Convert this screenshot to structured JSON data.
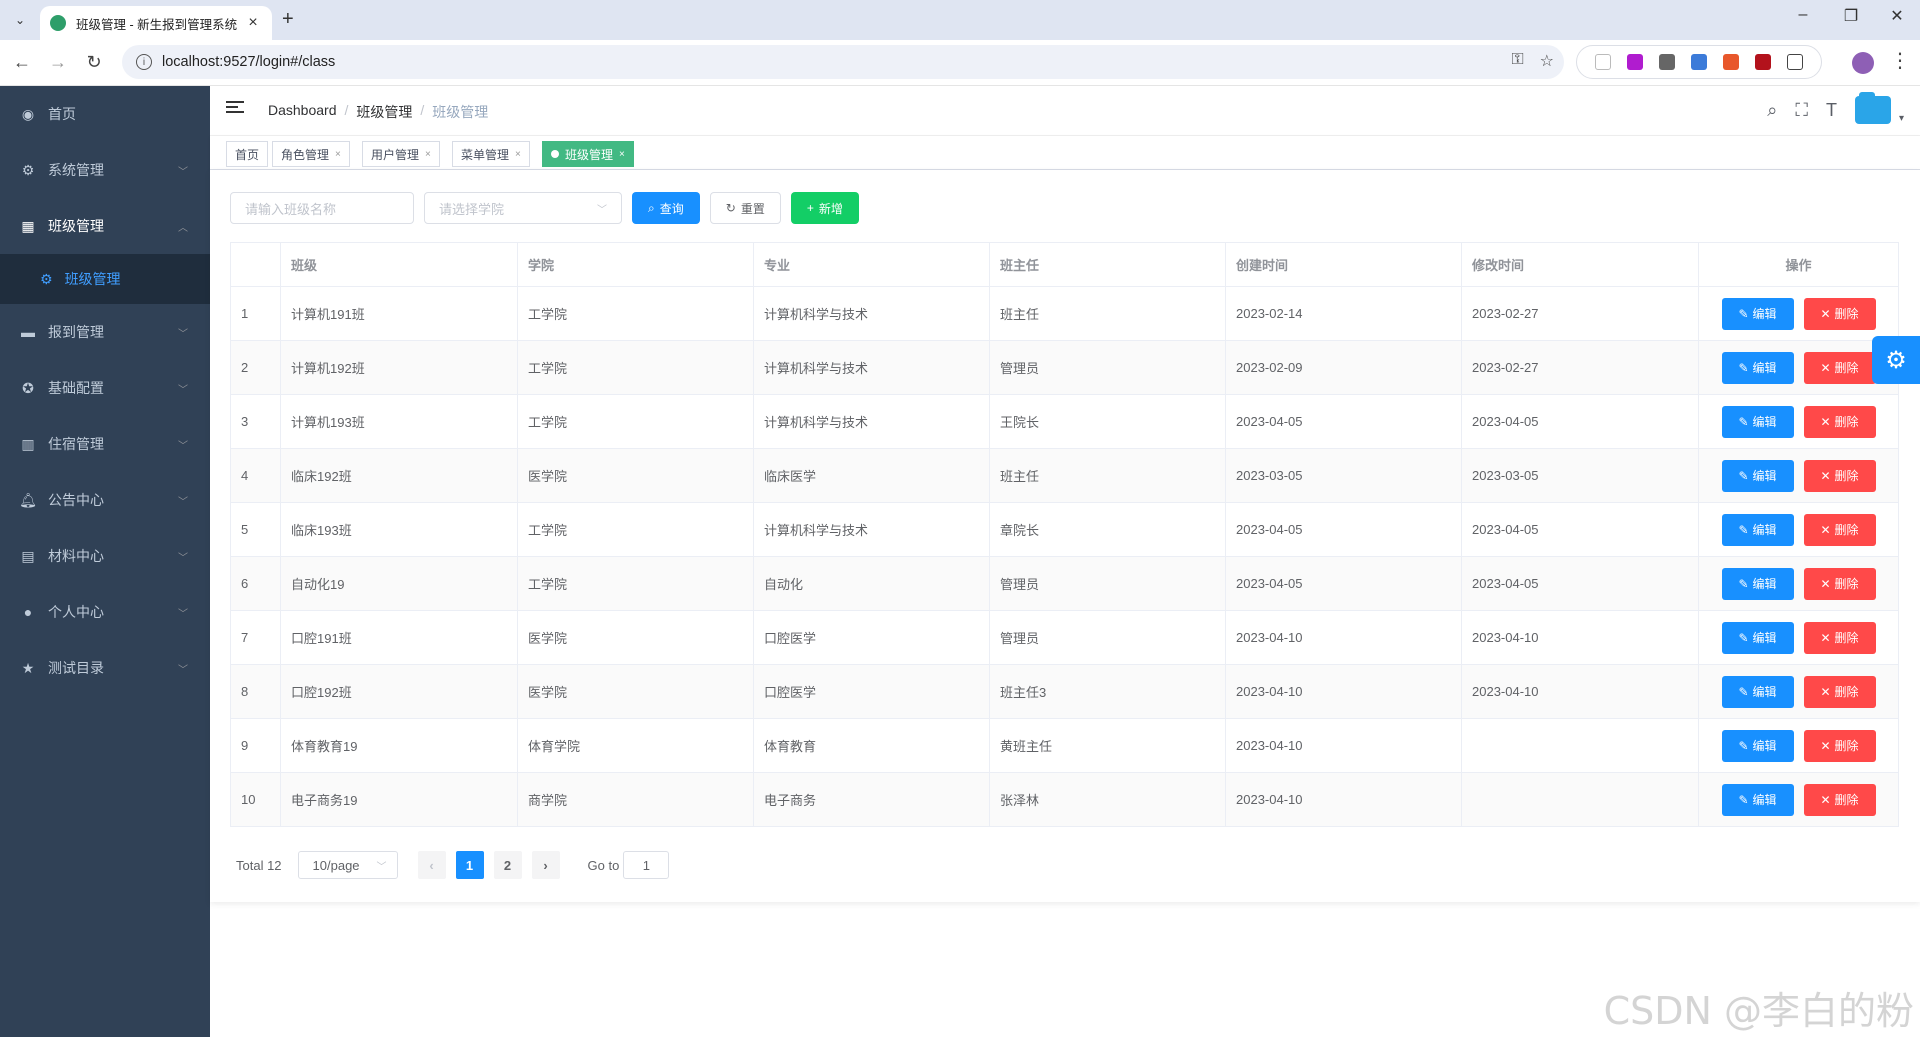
{
  "browser": {
    "tab_title": "班级管理 - 新生报到管理系统",
    "url": "localhost:9527/login#/class"
  },
  "sidebar": {
    "items": [
      {
        "label": "首页",
        "icon": "dashboard-icon"
      },
      {
        "label": "系统管理",
        "icon": "gear-icon"
      },
      {
        "label": "班级管理",
        "icon": "grid-icon",
        "open": true
      },
      {
        "label": "报到管理",
        "icon": "monitor-icon"
      },
      {
        "label": "基础配置",
        "icon": "compass-icon"
      },
      {
        "label": "住宿管理",
        "icon": "chart-icon"
      },
      {
        "label": "公告中心",
        "icon": "bell-icon"
      },
      {
        "label": "材料中心",
        "icon": "clipboard-icon"
      },
      {
        "label": "个人中心",
        "icon": "user-icon"
      },
      {
        "label": "测试目录",
        "icon": "star-icon"
      }
    ],
    "submenu_active": "班级管理"
  },
  "breadcrumb": [
    "Dashboard",
    "班级管理",
    "班级管理"
  ],
  "tags": [
    "首页",
    "角色管理",
    "用户管理",
    "菜单管理",
    "班级管理"
  ],
  "filter": {
    "class_name_placeholder": "请输入班级名称",
    "college_placeholder": "请选择学院",
    "search_label": "查询",
    "reset_label": "重置",
    "add_label": "新增"
  },
  "table": {
    "headers": [
      "",
      "班级",
      "学院",
      "专业",
      "班主任",
      "创建时间",
      "修改时间",
      "操作"
    ],
    "edit_label": "编辑",
    "delete_label": "删除",
    "rows": [
      {
        "idx": "1",
        "cls": "计算机191班",
        "college": "工学院",
        "major": "计算机科学与技术",
        "teacher": "班主任",
        "created": "2023-02-14",
        "modified": "2023-02-27"
      },
      {
        "idx": "2",
        "cls": "计算机192班",
        "college": "工学院",
        "major": "计算机科学与技术",
        "teacher": "管理员",
        "created": "2023-02-09",
        "modified": "2023-02-27"
      },
      {
        "idx": "3",
        "cls": "计算机193班",
        "college": "工学院",
        "major": "计算机科学与技术",
        "teacher": "王院长",
        "created": "2023-04-05",
        "modified": "2023-04-05"
      },
      {
        "idx": "4",
        "cls": "临床192班",
        "college": "医学院",
        "major": "临床医学",
        "teacher": "班主任",
        "created": "2023-03-05",
        "modified": "2023-03-05"
      },
      {
        "idx": "5",
        "cls": "临床193班",
        "college": "工学院",
        "major": "计算机科学与技术",
        "teacher": "章院长",
        "created": "2023-04-05",
        "modified": "2023-04-05"
      },
      {
        "idx": "6",
        "cls": "自动化19",
        "college": "工学院",
        "major": "自动化",
        "teacher": "管理员",
        "created": "2023-04-05",
        "modified": "2023-04-05"
      },
      {
        "idx": "7",
        "cls": "口腔191班",
        "college": "医学院",
        "major": "口腔医学",
        "teacher": "管理员",
        "created": "2023-04-10",
        "modified": "2023-04-10"
      },
      {
        "idx": "8",
        "cls": "口腔192班",
        "college": "医学院",
        "major": "口腔医学",
        "teacher": "班主任3",
        "created": "2023-04-10",
        "modified": "2023-04-10"
      },
      {
        "idx": "9",
        "cls": "体育教育19",
        "college": "体育学院",
        "major": "体育教育",
        "teacher": "黄班主任",
        "created": "2023-04-10",
        "modified": ""
      },
      {
        "idx": "10",
        "cls": "电子商务19",
        "college": "商学院",
        "major": "电子商务",
        "teacher": "张泽林",
        "created": "2023-04-10",
        "modified": ""
      }
    ]
  },
  "pagination": {
    "total": "Total 12",
    "page_size": "10/page",
    "pages": [
      "1",
      "2"
    ],
    "current": "1",
    "goto_label": "Go to",
    "goto_value": "1"
  },
  "watermark": "CSDN @李白的粉"
}
